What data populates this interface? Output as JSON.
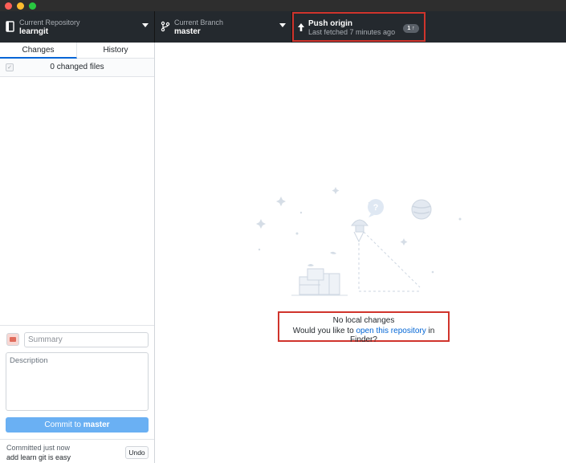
{
  "toolbar": {
    "repo_label": "Current Repository",
    "repo_name": "learngit",
    "branch_label": "Current Branch",
    "branch_name": "master",
    "push_title": "Push origin",
    "push_subtitle": "Last fetched 7 minutes ago",
    "push_badge": "1 ↑"
  },
  "sidebar": {
    "tabs": [
      {
        "label": "Changes",
        "selected": true
      },
      {
        "label": "History",
        "selected": false
      }
    ],
    "changed_files": "0 changed files",
    "summary_placeholder": "Summary",
    "description_placeholder": "Description",
    "commit_prefix": "Commit to",
    "commit_branch": "master",
    "last_commit_status": "Committed just now",
    "last_commit_message": "add learn git is easy",
    "undo_label": "Undo"
  },
  "main": {
    "no_changes_title": "No local changes",
    "prompt_prefix": "Would you like to",
    "prompt_link": "open this repository",
    "prompt_suffix": "in Finder?"
  },
  "icons": {
    "repo": "repo-icon",
    "branch": "branch-icon",
    "push": "arrow-up-icon",
    "illustration": "empty-state-illustration"
  },
  "colors": {
    "toolbar_bg": "#24292e",
    "accent_blue": "#0366d6",
    "commit_button": "#6ab0f3",
    "highlight_red": "#d0342c"
  }
}
